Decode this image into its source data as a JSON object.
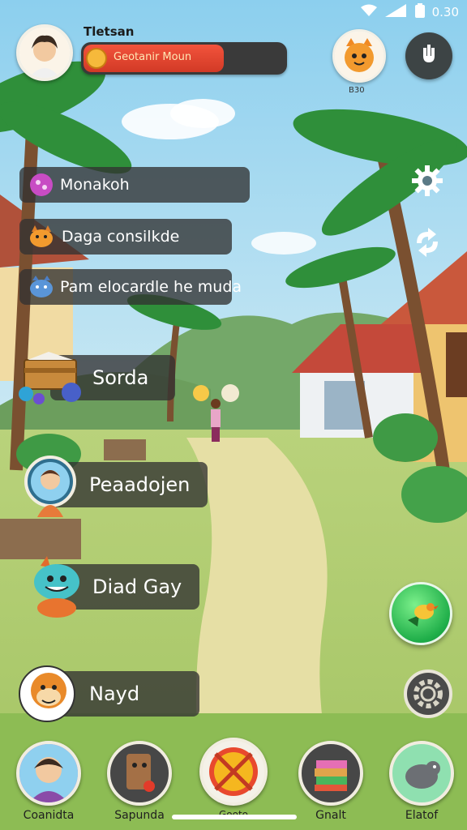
{
  "status_bar": {
    "time": "0.30"
  },
  "player": {
    "name": "Tletsan",
    "xp_label": "Geotanir Moun",
    "xp_progress": 0.68
  },
  "pet": {
    "label": "B30"
  },
  "menu": [
    {
      "label": "Monakoh",
      "icon": "potion-icon"
    },
    {
      "label": "Daga consilkde",
      "icon": "cat-icon"
    },
    {
      "label": "Pam elocardle he muda",
      "icon": "creature-icon"
    },
    {
      "label": "Sorda",
      "icon": "treasure-chest-icon"
    },
    {
      "label": "Peaadojen",
      "icon": "villager-avatar-icon"
    },
    {
      "label": "Diad Gay",
      "icon": "monster-icon"
    },
    {
      "label": "Nayd",
      "icon": "monkey-icon"
    }
  ],
  "bottom_nav": [
    {
      "label": "Coanidta",
      "icon": "profile-icon"
    },
    {
      "label": "Sapunda",
      "icon": "backpack-icon"
    },
    {
      "label": "Gooto",
      "icon": "ball-icon"
    },
    {
      "label": "Gnalt",
      "icon": "books-icon"
    },
    {
      "label": "Elatof",
      "icon": "creature-icon"
    }
  ],
  "colors": {
    "xp_fill": "#e1412c",
    "menu_bg": "#323232",
    "fab": "#1fae49",
    "accent": "#f6b93b"
  }
}
